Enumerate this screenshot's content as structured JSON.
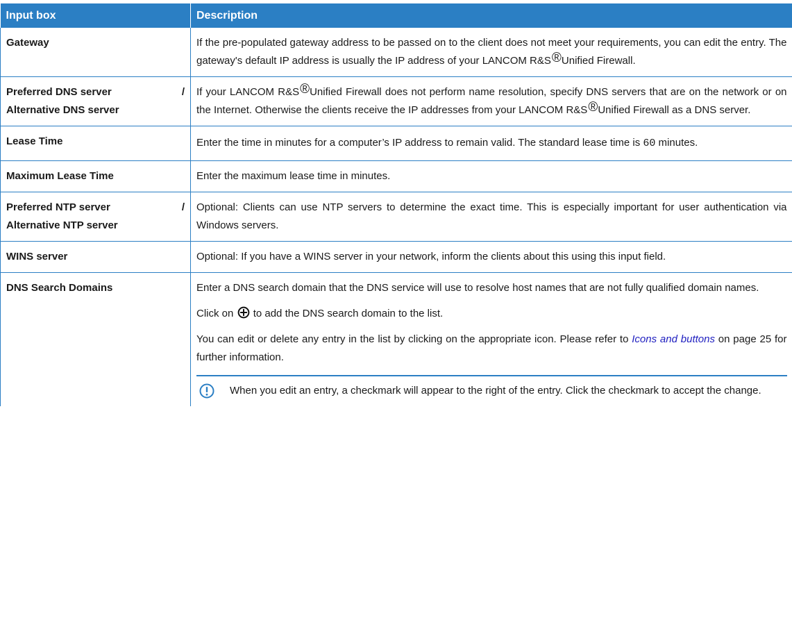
{
  "table": {
    "headers": [
      "Input box",
      "Description"
    ],
    "rows": {
      "gateway": {
        "label": "Gateway",
        "text1": "If the pre-populated gateway address to be passed on to the client does not meet your requirements, you can edit the entry. The gateway's default IP address is usually the IP address of your LANCOM R&S",
        "reg": "®",
        "text2": "Unified Firewall."
      },
      "dns": {
        "label_a1": "Preferred DNS server",
        "label_a2": "/",
        "label_b": "Alternative DNS server",
        "text1": "If your LANCOM R&S",
        "reg": "®",
        "text2": "Unified Firewall does not perform name resolution, specify DNS servers that are on the network or on the Internet. Otherwise the clients receive the IP addresses from your LANCOM R&S",
        "text3": "Unified Firewall as a DNS server."
      },
      "lease": {
        "label": "Lease Time",
        "text1": "Enter the time in minutes for a computer’s IP address to remain valid. The standard lease time is ",
        "value": "60",
        "text2": " minutes."
      },
      "max_lease": {
        "label": "Maximum Lease Time",
        "text": "Enter the maximum lease time in minutes."
      },
      "ntp": {
        "label_a1": "Preferred NTP server",
        "label_a2": "/",
        "label_b": "Alternative NTP server",
        "text": "Optional: Clients can use NTP servers to determine the exact time. This is especially important for user authentication via Windows servers."
      },
      "wins": {
        "label": "WINS server",
        "text": "Optional: If you have a WINS server in your network, inform the clients about this using this input field."
      },
      "dns_search": {
        "label": "DNS Search Domains",
        "para1": "Enter a DNS search domain that the DNS service will use to resolve host names that are not fully qualified domain names.",
        "para2_a": "Click on ",
        "para2_b": " to add the DNS search domain to the list.",
        "para3_a": "You can edit or delete any entry in the list by clicking on the appropriate icon. Please refer to ",
        "para3_link": "Icons and buttons",
        "para3_b": " on page 25 for further information.",
        "note": "When you edit an entry, a checkmark will appear to the right of the entry. Click the checkmark to accept the change."
      }
    }
  },
  "icons": {
    "add": "plus-circle-icon",
    "note": "info-note-icon"
  },
  "colors": {
    "header_bg": "#2b7fc4",
    "border": "#2b7fc4",
    "link": "#2020c0"
  }
}
